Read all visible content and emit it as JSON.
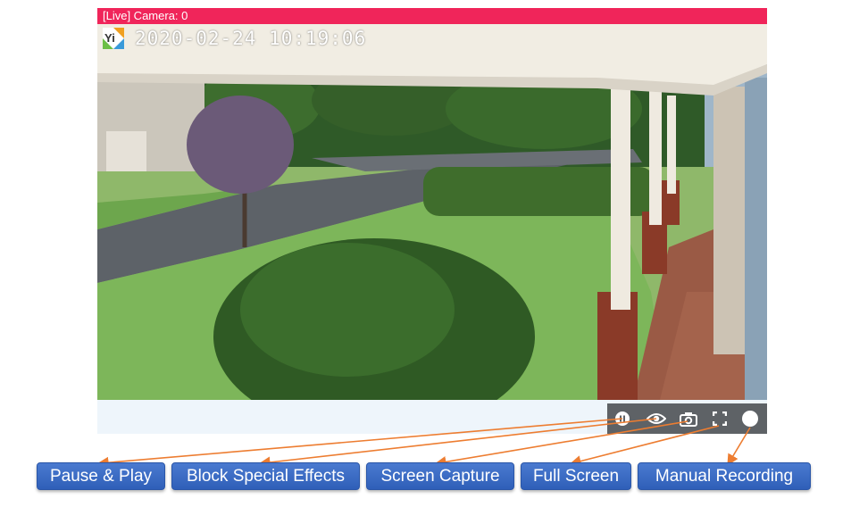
{
  "player": {
    "title": "[Live] Camera: 0",
    "osd_timestamp": "2020-02-24 10:19:06",
    "osd_logo_icon": "camera-brand-logo"
  },
  "controls": [
    {
      "name": "pause-play",
      "icon": "pause-icon"
    },
    {
      "name": "block-special-effects",
      "icon": "eye-icon"
    },
    {
      "name": "screen-capture",
      "icon": "camera-icon"
    },
    {
      "name": "full-screen",
      "icon": "fullscreen-icon"
    },
    {
      "name": "manual-recording",
      "icon": "record-circle-icon"
    }
  ],
  "callouts": {
    "pause_play": "Pause & Play",
    "block_special_effects": "Block Special Effects",
    "screen_capture": "Screen Capture",
    "full_screen": "Full Screen",
    "manual_recording": "Manual Recording"
  },
  "colors": {
    "title_bar": "#f0255a",
    "control_bar": "#5e6266",
    "callout_button": "#3a6bc4",
    "arrow": "#ed7d31"
  }
}
